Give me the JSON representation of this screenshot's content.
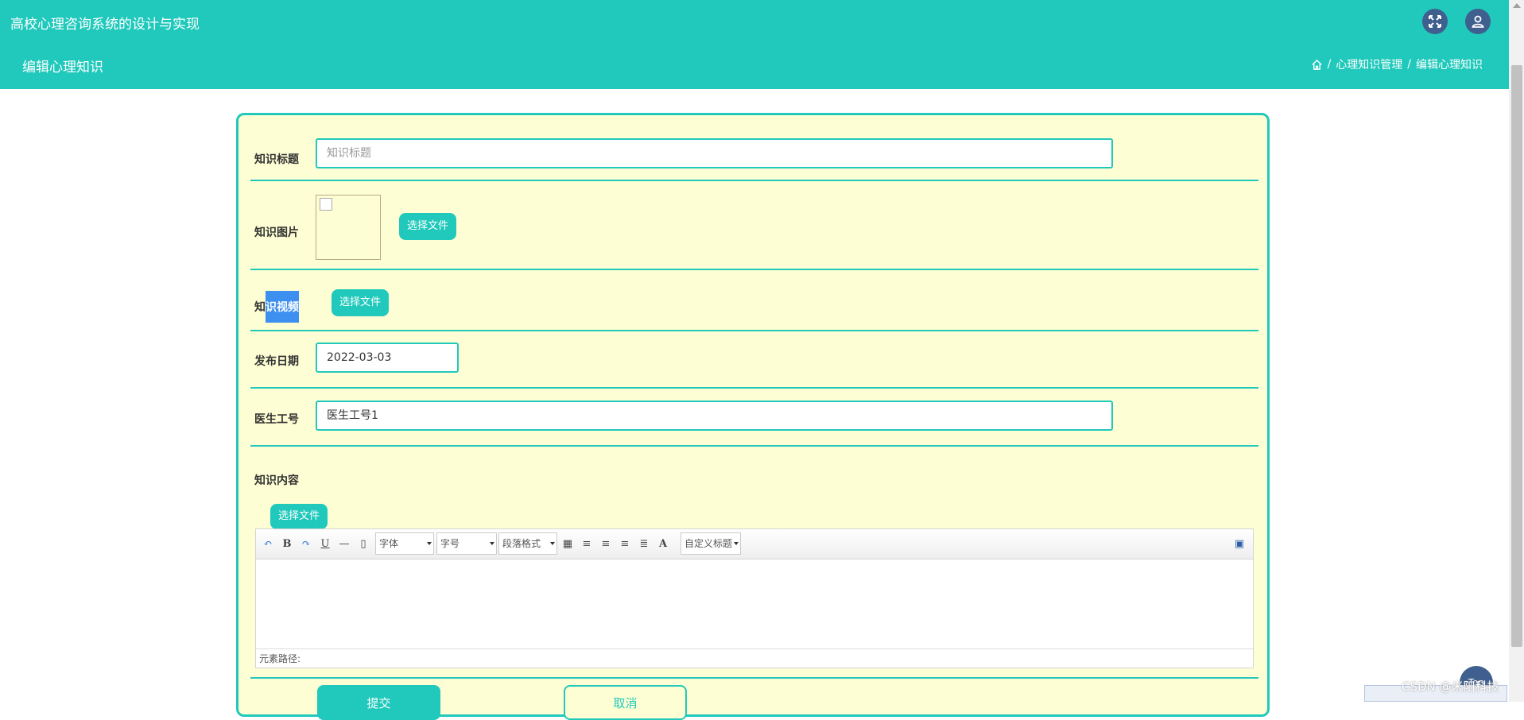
{
  "header": {
    "app_title": "高校心理咨询系统的设计与实现",
    "page_heading": "编辑心理知识",
    "breadcrumb": {
      "parent": "心理知识管理",
      "separator": "/",
      "current": "编辑心理知识"
    },
    "icons": [
      "fullscreen-icon",
      "user-icon",
      "home-icon"
    ]
  },
  "form": {
    "title": {
      "label": "知识标题",
      "placeholder": "知识标题",
      "value": ""
    },
    "image": {
      "label": "知识图片",
      "button": "选择文件"
    },
    "video": {
      "label_prefix": "知",
      "label_highlight": "识视频",
      "button": "选择文件"
    },
    "publish_date": {
      "label": "发布日期",
      "value": "2022-03-03"
    },
    "doctor_id": {
      "label": "医生工号",
      "value": "医生工号1"
    },
    "content": {
      "label": "知识内容",
      "button": "选择文件"
    }
  },
  "editor": {
    "font_family": "字体",
    "font_size": "字号",
    "paragraph": "段落格式",
    "custom_title": "自定义标题",
    "status_path": "元素路径:"
  },
  "actions": {
    "submit": "提交",
    "cancel": "取消"
  },
  "overlay": {
    "float_button": "Top",
    "watermark": "CSDN @米阳科技"
  },
  "colors": {
    "primary": "#20c9bb",
    "card_bg": "#fefed4",
    "icon_bg": "#3f5f8f",
    "highlight": "#3d8ff0"
  }
}
